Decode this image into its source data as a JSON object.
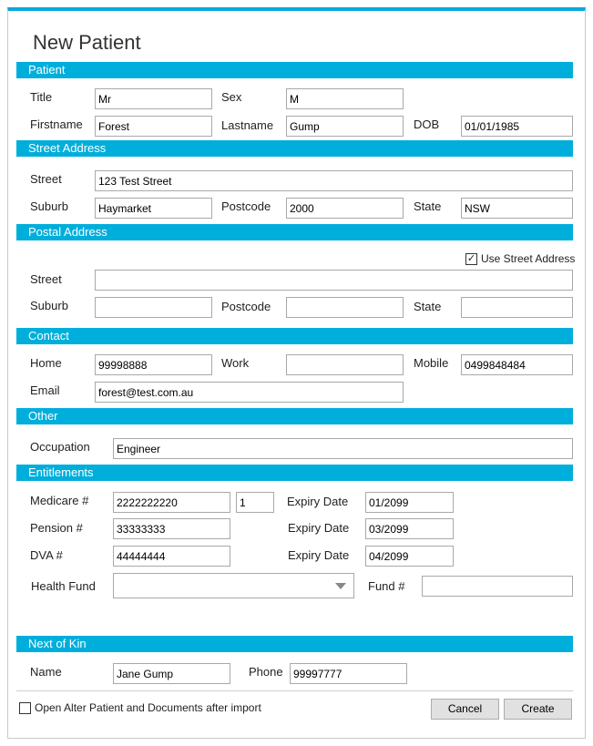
{
  "window": {
    "title": "New Patient"
  },
  "sections": {
    "patient": "Patient",
    "street_address": "Street Address",
    "postal_address": "Postal Address",
    "contact": "Contact",
    "other": "Other",
    "entitlements": "Entitlements",
    "next_of_kin": "Next of Kin"
  },
  "patient": {
    "title_label": "Title",
    "title_value": "Mr",
    "sex_label": "Sex",
    "sex_value": "M",
    "firstname_label": "Firstname",
    "firstname_value": "Forest",
    "lastname_label": "Lastname",
    "lastname_value": "Gump",
    "dob_label": "DOB",
    "dob_value": "01/01/1985"
  },
  "street_address": {
    "street_label": "Street",
    "street_value": "123 Test Street",
    "suburb_label": "Suburb",
    "suburb_value": "Haymarket",
    "postcode_label": "Postcode",
    "postcode_value": "2000",
    "state_label": "State",
    "state_value": "NSW"
  },
  "postal_address": {
    "use_street_label": "Use Street Address",
    "use_street_checked": true,
    "street_label": "Street",
    "street_value": "",
    "suburb_label": "Suburb",
    "suburb_value": "",
    "postcode_label": "Postcode",
    "postcode_value": "",
    "state_label": "State",
    "state_value": ""
  },
  "contact": {
    "home_label": "Home",
    "home_value": "99998888",
    "work_label": "Work",
    "work_value": "",
    "mobile_label": "Mobile",
    "mobile_value": "0499848484",
    "email_label": "Email",
    "email_value": "forest@test.com.au"
  },
  "other": {
    "occupation_label": "Occupation",
    "occupation_value": "Engineer"
  },
  "entitlements": {
    "medicare_label": "Medicare #",
    "medicare_value": "2222222220",
    "medicare_irn": "1",
    "medicare_expiry_label": "Expiry Date",
    "medicare_expiry_value": "01/2099",
    "pension_label": "Pension #",
    "pension_value": "33333333",
    "pension_expiry_label": "Expiry Date",
    "pension_expiry_value": "03/2099",
    "dva_label": "DVA #",
    "dva_value": "44444444",
    "dva_expiry_label": "Expiry Date",
    "dva_expiry_value": "04/2099",
    "health_fund_label": "Health Fund",
    "health_fund_value": "",
    "fund_no_label": "Fund #",
    "fund_no_value": ""
  },
  "next_of_kin": {
    "name_label": "Name",
    "name_value": "Jane Gump",
    "phone_label": "Phone",
    "phone_value": "99997777"
  },
  "footer": {
    "open_after_import_label": "Open Alter Patient and Documents after import",
    "open_after_import_checked": false,
    "cancel_label": "Cancel",
    "create_label": "Create"
  },
  "colors": {
    "accent": "#00aedb",
    "top_border": "#0aa8d8"
  },
  "icons": {
    "use_street_checkbox": "checkmark-icon",
    "health_fund_dropdown": "chevron-down-icon"
  }
}
